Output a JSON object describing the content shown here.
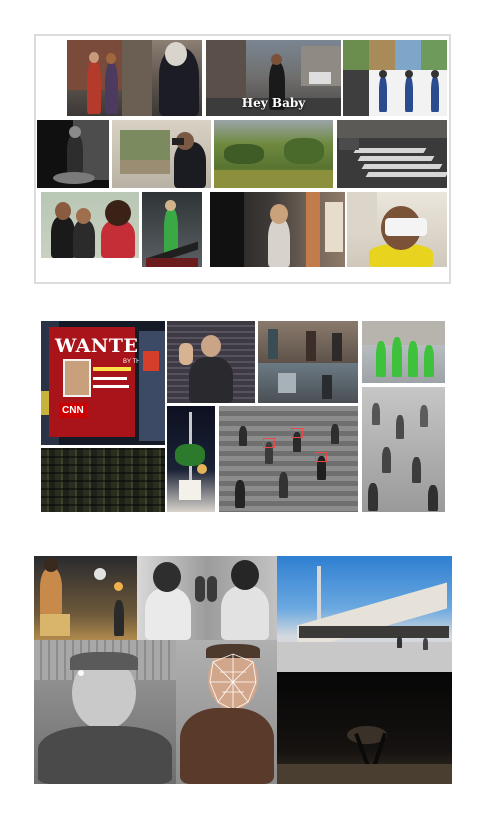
{
  "figure": {
    "panel_1": {
      "caption": "Hey Baby"
    },
    "panel_2": {
      "billboard_title": "WANTED",
      "billboard_subtitle": "BY THE FBI",
      "billboard_logo": "CNN"
    }
  },
  "colors": {
    "frame_border": "#dcdcdc",
    "background": "#ffffff",
    "green_highlight": "#3ec23e",
    "cnn_red": "#cc0000",
    "billboard_red": "#a8141a"
  }
}
